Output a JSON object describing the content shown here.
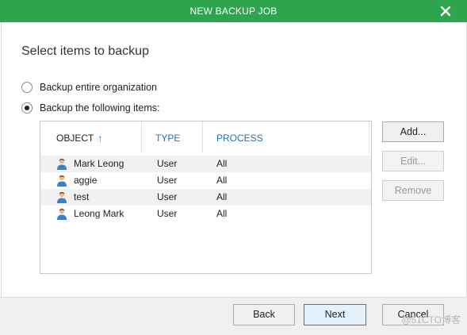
{
  "window": {
    "title": "NEW BACKUP JOB",
    "close_icon": "close-icon",
    "titlebar_color": "#2ea44f"
  },
  "page": {
    "heading": "Select items to backup"
  },
  "options": [
    {
      "label": "Backup entire organization",
      "checked": false
    },
    {
      "label": "Backup the following items:",
      "checked": true
    }
  ],
  "table": {
    "columns": [
      "OBJECT",
      "TYPE",
      "PROCESS"
    ],
    "sort_indicator": "↑",
    "header_accent": "#2471b8",
    "rows": [
      {
        "object": "Mark Leong",
        "type": "User",
        "process": "All",
        "icon": "user-icon"
      },
      {
        "object": "aggie",
        "type": "User",
        "process": "All",
        "icon": "user-icon"
      },
      {
        "object": "test",
        "type": "User",
        "process": "All",
        "icon": "user-icon"
      },
      {
        "object": "Leong Mark",
        "type": "User",
        "process": "All",
        "icon": "user-icon"
      }
    ]
  },
  "side_buttons": {
    "add": "Add...",
    "edit": "Edit...",
    "remove": "Remove"
  },
  "footer_buttons": {
    "back": "Back",
    "next": "Next",
    "cancel": "Cancel"
  },
  "watermark": "@51CTO博客"
}
